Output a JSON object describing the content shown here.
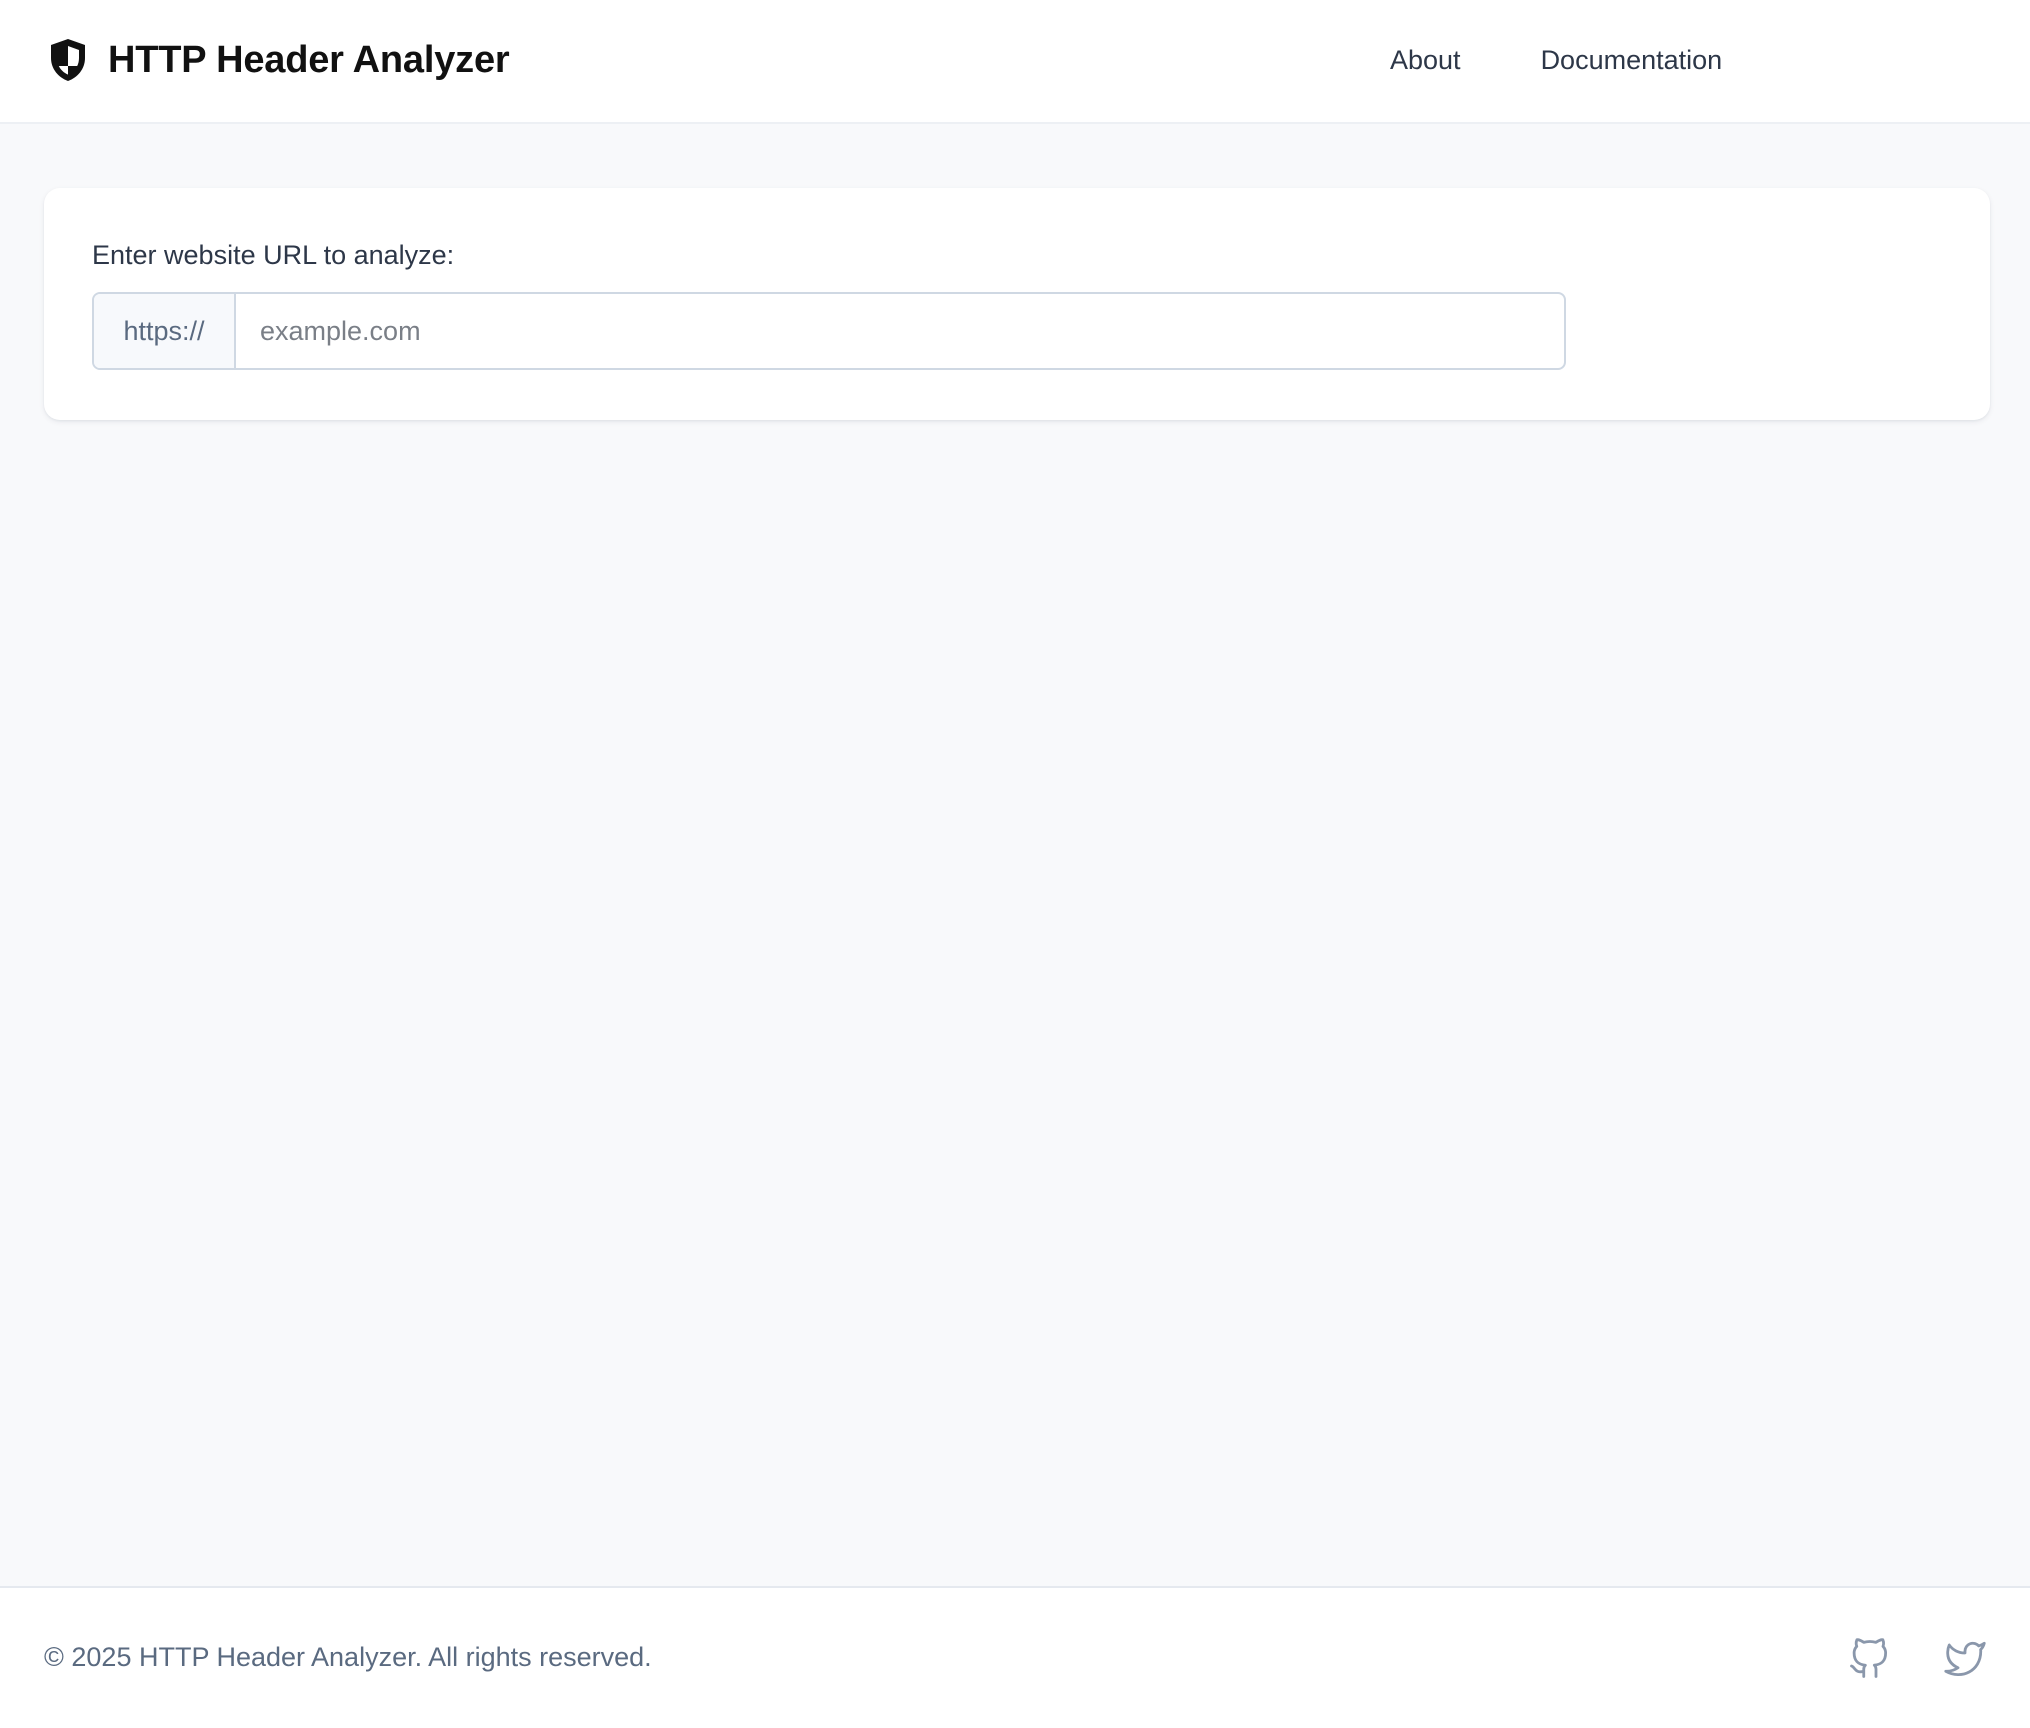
{
  "header": {
    "title": "HTTP Header Analyzer",
    "logo_icon": "shield-icon",
    "nav": [
      {
        "label": "About"
      },
      {
        "label": "Documentation"
      }
    ]
  },
  "main": {
    "url_label": "Enter website URL to analyze:",
    "url_prefix": "https://",
    "url_placeholder": "example.com",
    "url_value": ""
  },
  "footer": {
    "copyright": "© 2025 HTTP Header Analyzer. All rights reserved.",
    "social": [
      {
        "icon": "github-icon"
      },
      {
        "icon": "twitter-icon"
      }
    ]
  },
  "colors": {
    "background": "#f8f9fb",
    "surface": "#ffffff",
    "text": "#2d3748",
    "muted": "#5a6a80",
    "border": "#cfd8e3"
  }
}
